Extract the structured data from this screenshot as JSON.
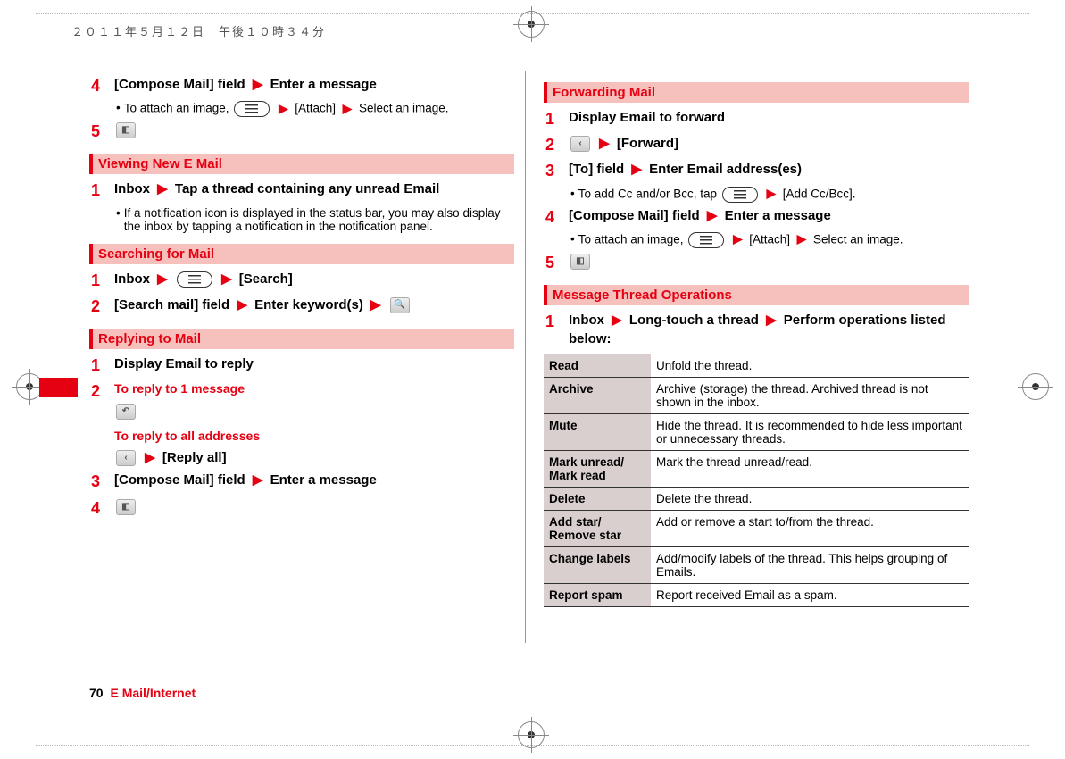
{
  "timestamp": "２０１１年５月１２日　午後１０時３４分",
  "footer": {
    "page": "70",
    "section": "E Mail/Internet"
  },
  "left": {
    "top": {
      "step4": {
        "part1": "[Compose Mail] field",
        "part2": "Enter a message",
        "bullet_a": "To attach an image,",
        "bullet_b": "[Attach]",
        "bullet_c": "Select an image."
      }
    },
    "viewing": {
      "header": "Viewing New E Mail",
      "step1_a": "Inbox",
      "step1_b": "Tap a thread containing any unread Email",
      "bullet": "If a notification icon is displayed in the status bar, you may also display the inbox by tapping a notification in the notification panel."
    },
    "searching": {
      "header": "Searching for Mail",
      "step1_a": "Inbox",
      "step1_b": "[Search]",
      "step2_a": "[Search mail] field",
      "step2_b": "Enter keyword(s)"
    },
    "replying": {
      "header": "Replying to Mail",
      "step1": "Display Email to reply",
      "sub_a": "To reply to 1 message",
      "sub_b": "To reply to all addresses",
      "reply_all": "[Reply all]",
      "step3_a": "[Compose Mail] field",
      "step3_b": "Enter a message"
    }
  },
  "right": {
    "forwarding": {
      "header": "Forwarding Mail",
      "step1": "Display Email to forward",
      "step2": "[Forward]",
      "step3_a": "[To] field",
      "step3_b": "Enter Email address(es)",
      "step3_bullet_a": "To add Cc and/or Bcc, tap",
      "step3_bullet_b": "[Add Cc/Bcc].",
      "step4_a": "[Compose Mail] field",
      "step4_b": "Enter a message",
      "step4_bullet_a": "To attach an image,",
      "step4_bullet_b": "[Attach]",
      "step4_bullet_c": "Select an image."
    },
    "thread": {
      "header": "Message Thread Operations",
      "step1_a": "Inbox",
      "step1_b": "Long-touch a thread",
      "step1_c": "Perform operations listed below:",
      "rows": [
        {
          "k": "Read",
          "v": "Unfold the thread."
        },
        {
          "k": "Archive",
          "v": "Archive (storage) the thread. Archived thread is not shown in the inbox."
        },
        {
          "k": "Mute",
          "v": "Hide the thread. It is recommended to hide less important or unnecessary threads."
        },
        {
          "k": "Mark unread/\nMark read",
          "v": "Mark the thread unread/read."
        },
        {
          "k": "Delete",
          "v": "Delete the thread."
        },
        {
          "k": "Add star/\nRemove star",
          "v": "Add or remove a start to/from the thread."
        },
        {
          "k": "Change labels",
          "v": "Add/modify labels of the thread. This helps grouping of Emails."
        },
        {
          "k": "Report spam",
          "v": "Report received Email as a spam."
        }
      ]
    }
  }
}
